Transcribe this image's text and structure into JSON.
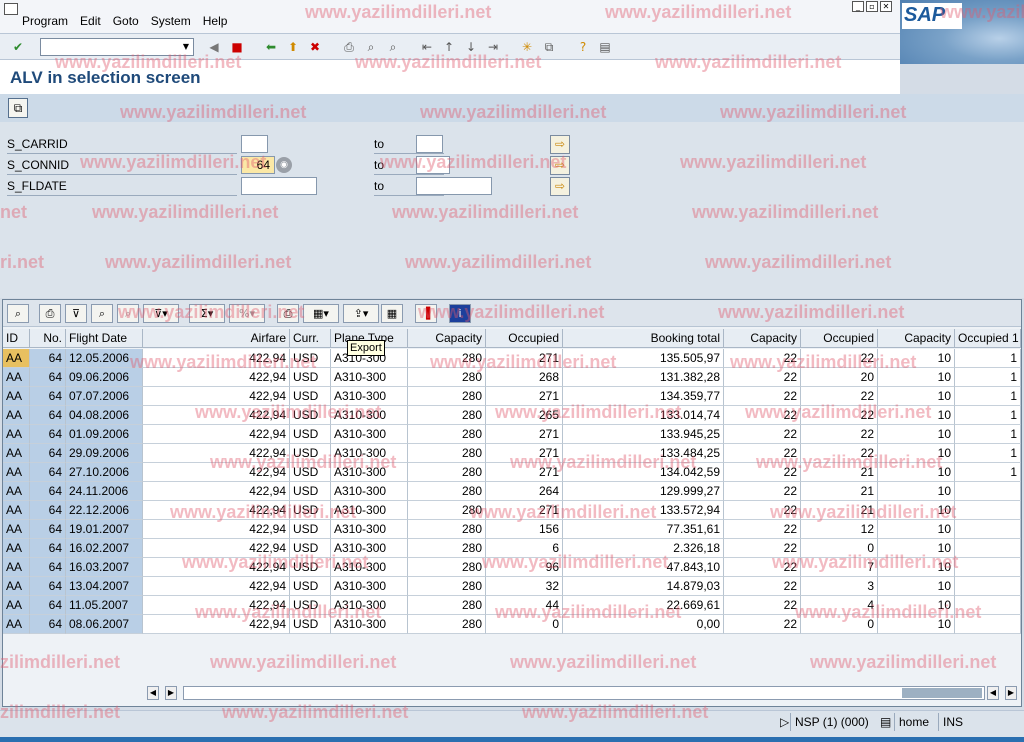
{
  "menu": {
    "items": [
      "Program",
      "Edit",
      "Goto",
      "System",
      "Help"
    ],
    "brand": "SAP"
  },
  "window_buttons": [
    "minimize",
    "restore",
    "close"
  ],
  "toolbar": {
    "command_field_value": "",
    "icons": [
      "check-icon",
      "back-icon",
      "save-icon",
      "back-arrow-icon",
      "exit-icon",
      "cancel-icon",
      "print-icon",
      "find-icon",
      "find-next-icon",
      "first-page-icon",
      "previous-page-icon",
      "next-page-icon",
      "last-page-icon",
      "create-session-icon",
      "shortcut-icon",
      "help-icon",
      "layout-menu-icon"
    ]
  },
  "page_title": "ALV in selection screen",
  "selection": {
    "rows": [
      {
        "label": "S_CARRID",
        "low": "",
        "to": "to",
        "high": ""
      },
      {
        "label": "S_CONNID",
        "low": "64",
        "to": "to",
        "high": ""
      },
      {
        "label": "S_FLDATE",
        "low": "",
        "to": "to",
        "high": ""
      }
    ]
  },
  "alv": {
    "tooltip": "Export",
    "columns": [
      "ID",
      "No.",
      "Flight Date",
      "Airfare",
      "Curr.",
      "Plane Type",
      "Capacity",
      "Occupied",
      "Booking total",
      "Capacity",
      "Occupied",
      "Capacity",
      "Occupied 1"
    ],
    "rows": [
      [
        "AA",
        "64",
        "12.05.2006",
        "422,94",
        "USD",
        "A310-300",
        "280",
        "271",
        "135.505,97",
        "22",
        "22",
        "10",
        "1"
      ],
      [
        "AA",
        "64",
        "09.06.2006",
        "422,94",
        "USD",
        "A310-300",
        "280",
        "268",
        "131.382,28",
        "22",
        "20",
        "10",
        "1"
      ],
      [
        "AA",
        "64",
        "07.07.2006",
        "422,94",
        "USD",
        "A310-300",
        "280",
        "271",
        "134.359,77",
        "22",
        "22",
        "10",
        "1"
      ],
      [
        "AA",
        "64",
        "04.08.2006",
        "422,94",
        "USD",
        "A310-300",
        "280",
        "265",
        "133.014,74",
        "22",
        "22",
        "10",
        "1"
      ],
      [
        "AA",
        "64",
        "01.09.2006",
        "422,94",
        "USD",
        "A310-300",
        "280",
        "271",
        "133.945,25",
        "22",
        "22",
        "10",
        "1"
      ],
      [
        "AA",
        "64",
        "29.09.2006",
        "422,94",
        "USD",
        "A310-300",
        "280",
        "271",
        "133.484,25",
        "22",
        "22",
        "10",
        "1"
      ],
      [
        "AA",
        "64",
        "27.10.2006",
        "422,94",
        "USD",
        "A310-300",
        "280",
        "271",
        "134.042,59",
        "22",
        "21",
        "10",
        "1"
      ],
      [
        "AA",
        "64",
        "24.11.2006",
        "422,94",
        "USD",
        "A310-300",
        "280",
        "264",
        "129.999,27",
        "22",
        "21",
        "10",
        ""
      ],
      [
        "AA",
        "64",
        "22.12.2006",
        "422,94",
        "USD",
        "A310-300",
        "280",
        "271",
        "133.572,94",
        "22",
        "21",
        "10",
        ""
      ],
      [
        "AA",
        "64",
        "19.01.2007",
        "422,94",
        "USD",
        "A310-300",
        "280",
        "156",
        "77.351,61",
        "22",
        "12",
        "10",
        ""
      ],
      [
        "AA",
        "64",
        "16.02.2007",
        "422,94",
        "USD",
        "A310-300",
        "280",
        "6",
        "2.326,18",
        "22",
        "0",
        "10",
        ""
      ],
      [
        "AA",
        "64",
        "16.03.2007",
        "422,94",
        "USD",
        "A310-300",
        "280",
        "96",
        "47.843,10",
        "22",
        "7",
        "10",
        ""
      ],
      [
        "AA",
        "64",
        "13.04.2007",
        "422,94",
        "USD",
        "A310-300",
        "280",
        "32",
        "14.879,03",
        "22",
        "3",
        "10",
        ""
      ],
      [
        "AA",
        "64",
        "11.05.2007",
        "422,94",
        "USD",
        "A310-300",
        "280",
        "44",
        "22.669,61",
        "22",
        "4",
        "10",
        ""
      ],
      [
        "AA",
        "64",
        "08.06.2007",
        "422,94",
        "USD",
        "A310-300",
        "280",
        "0",
        "0,00",
        "22",
        "0",
        "10",
        ""
      ]
    ]
  },
  "status": {
    "system": "NSP (1) (000)",
    "server": "home",
    "mode": "INS"
  },
  "watermark": "www.yazilimdilleri.net",
  "watermark_fragments": [
    "net",
    "ri.net",
    "zilimdilleri.net",
    "zilimdilleri.net",
    "www.yazilim"
  ]
}
